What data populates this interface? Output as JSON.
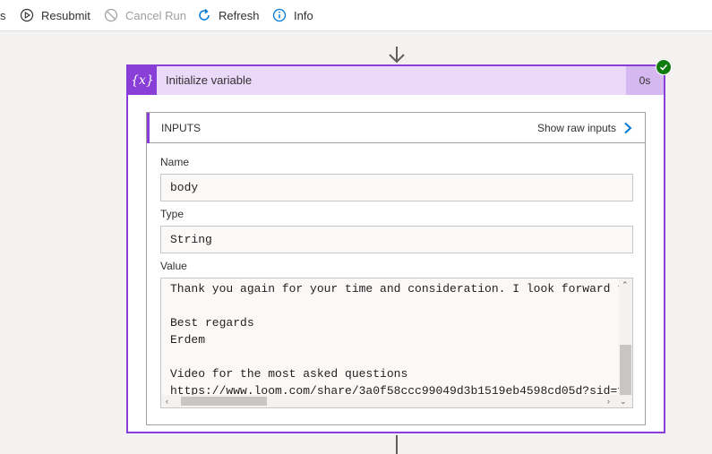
{
  "toolbar": {
    "items": [
      {
        "label": "s",
        "icon": "back-icon"
      },
      {
        "label": "Resubmit",
        "icon": "resubmit-icon"
      },
      {
        "label": "Cancel Run",
        "icon": "cancel-icon",
        "disabled": true
      },
      {
        "label": "Refresh",
        "icon": "refresh-icon"
      },
      {
        "label": "Info",
        "icon": "info-icon"
      }
    ]
  },
  "action": {
    "title": "Initialize variable",
    "icon_text": "{x}",
    "duration": "0s",
    "status": "succeeded"
  },
  "inputs": {
    "title": "INPUTS",
    "raw_link": "Show raw inputs",
    "name_label": "Name",
    "name_value": "body",
    "type_label": "Type",
    "type_value": "String",
    "value_label": "Value",
    "value_text": "Thank you again for your time and consideration. I look forward t\n\nBest regards\nErdem\n\nVideo for the most asked questions\nhttps://www.loom.com/share/3a0f58ccc99049d3b1519eb4598cd05d?sid=f"
  },
  "colors": {
    "accent": "#8a3ed8",
    "header_bg": "#ead9f8",
    "success": "#107c10",
    "refresh_blue": "#0078d4"
  }
}
